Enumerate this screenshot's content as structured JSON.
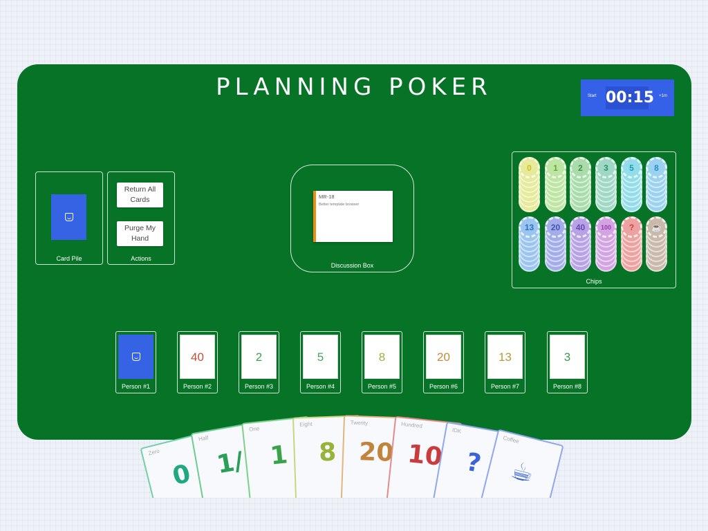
{
  "app": {
    "title": "PLANNING POKER",
    "table_color": "#067327",
    "accent": "#3561e8"
  },
  "timer": {
    "start_label": "Start",
    "time": "00:15",
    "add_label": "+1m"
  },
  "card_pile": {
    "label": "Card Pile",
    "icon": "deck-icon"
  },
  "actions": {
    "label": "Actions",
    "return_all": "Return All Cards",
    "purge_hand": "Purge My Hand"
  },
  "discussion": {
    "label": "Discussion Box",
    "ticket_id": "MR-18",
    "ticket_desc": "Better template browser"
  },
  "chips": {
    "label": "Chips",
    "items": [
      {
        "label": "0",
        "color": "#e7ea9a",
        "text": "#c9c020"
      },
      {
        "label": "1",
        "color": "#bfe5a3",
        "text": "#6aa53e"
      },
      {
        "label": "2",
        "color": "#a9dcaa",
        "text": "#3f9448"
      },
      {
        "label": "3",
        "color": "#9fd8c4",
        "text": "#2d8e72"
      },
      {
        "label": "5",
        "color": "#93ddea",
        "text": "#1b9bb5"
      },
      {
        "label": "8",
        "color": "#9ad2ef",
        "text": "#2a8fc8"
      },
      {
        "label": "13",
        "color": "#9bc4ef",
        "text": "#2c71c4"
      },
      {
        "label": "20",
        "color": "#a3aee8",
        "text": "#4553b5"
      },
      {
        "label": "40",
        "color": "#b7a3e3",
        "text": "#6b45b8"
      },
      {
        "label": "100",
        "color": "#d2a4e1",
        "text": "#9a3bb4"
      },
      {
        "label": "?",
        "color": "#eda2a2",
        "text": "#d04040"
      },
      {
        "label": "☕",
        "color": "#c9b9ab",
        "text": "#6b4e36"
      }
    ]
  },
  "players": [
    {
      "label": "Person #1",
      "value": "",
      "face_down": true,
      "color": "#3563e3"
    },
    {
      "label": "Person #2",
      "value": "40",
      "face_down": false,
      "color": "#c0503a"
    },
    {
      "label": "Person #3",
      "value": "2",
      "face_down": false,
      "color": "#3fa054"
    },
    {
      "label": "Person #4",
      "value": "5",
      "face_down": false,
      "color": "#4aa65a"
    },
    {
      "label": "Person #5",
      "value": "8",
      "face_down": false,
      "color": "#9bb23a"
    },
    {
      "label": "Person #6",
      "value": "20",
      "face_down": false,
      "color": "#c38a3c"
    },
    {
      "label": "Person #7",
      "value": "13",
      "face_down": false,
      "color": "#b59a3a"
    },
    {
      "label": "Person #8",
      "value": "3",
      "face_down": false,
      "color": "#3f9a4e"
    }
  ],
  "hand": [
    {
      "name": "Zero",
      "value": "0",
      "color": "#1fa882",
      "border": "#6fd0a8"
    },
    {
      "name": "Half",
      "value": "1/",
      "color": "#2d9e58",
      "border": "#6ccb8e"
    },
    {
      "name": "One",
      "value": "1",
      "color": "#3aa34a",
      "border": "#7cd08a"
    },
    {
      "name": "Eight",
      "value": "8",
      "color": "#98b23a",
      "border": "#c7d57d"
    },
    {
      "name": "Twenty",
      "value": "20",
      "color": "#c1843d",
      "border": "#e2b47e"
    },
    {
      "name": "Hundred",
      "value": "10",
      "color": "#c93c3c",
      "border": "#e38b8b"
    },
    {
      "name": "IDK",
      "value": "?",
      "color": "#3a63d8",
      "border": "#8ea6ef"
    },
    {
      "name": "Coffee",
      "value": "☕",
      "color": "#3a63d8",
      "border": "#8ea6ef"
    }
  ]
}
